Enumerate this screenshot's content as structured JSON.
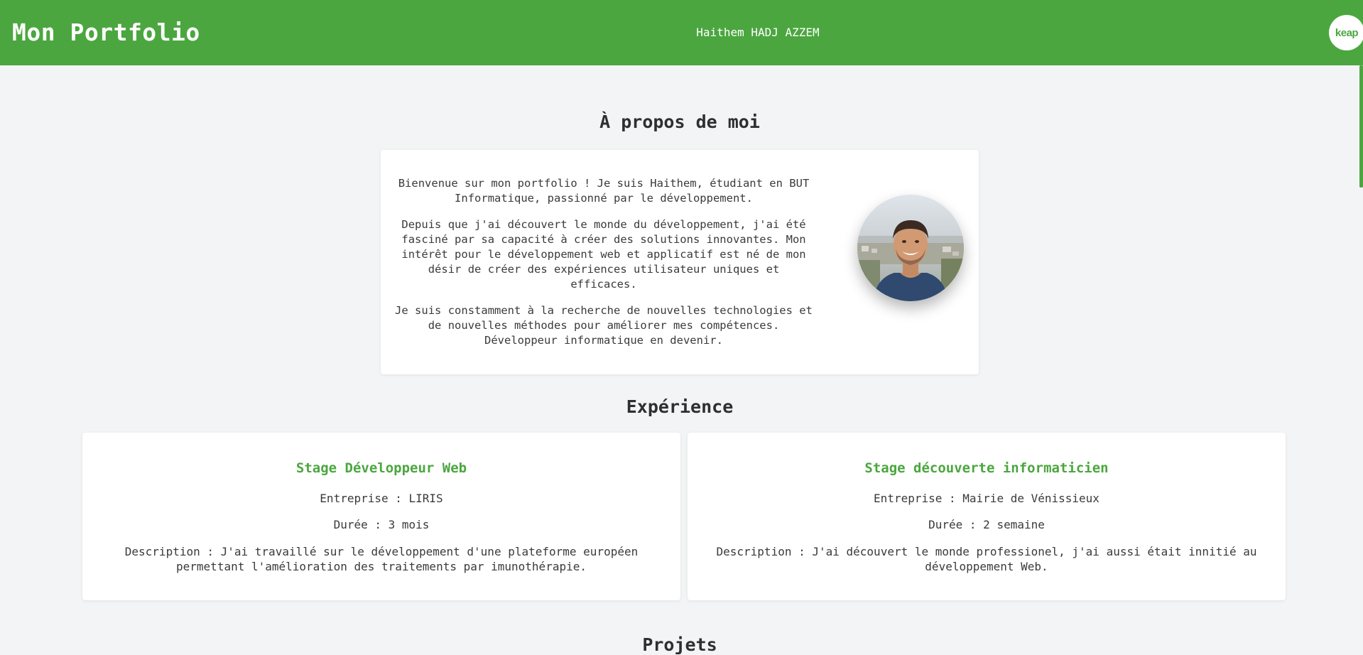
{
  "header": {
    "title": "Mon Portfolio",
    "author": "Haithem HADJ AZZEM",
    "badge_label": "keap",
    "accent_color": "#4ba63f"
  },
  "about": {
    "heading": "À propos de moi",
    "paragraphs": [
      "Bienvenue sur mon portfolio ! Je suis Haithem, étudiant en BUT Informatique, passionné par le développement.",
      "Depuis que j'ai découvert le monde du développement, j'ai été fasciné par sa capacité à créer des solutions innovantes. Mon intérêt pour le développement web et applicatif est né de mon désir de créer des expériences utilisateur uniques et efficaces.",
      "Je suis constamment à la recherche de nouvelles technologies et de nouvelles méthodes pour améliorer mes compétences. Développeur informatique en devenir."
    ]
  },
  "experience": {
    "heading": "Expérience",
    "items": [
      {
        "title": "Stage Développeur Web",
        "company": "Entreprise : LIRIS",
        "duration": "Durée : 3 mois",
        "description": "Description : J'ai travaillé sur le développement d'une plateforme européen permettant l'amélioration des traitements par imunothérapie."
      },
      {
        "title": "Stage découverte informaticien",
        "company": "Entreprise : Mairie de Vénissieux",
        "duration": "Durée : 2 semaine",
        "description": "Description : J'ai découvert le monde professionel, j'ai aussi était innitié au développement Web."
      }
    ]
  },
  "projects": {
    "heading": "Projets"
  }
}
